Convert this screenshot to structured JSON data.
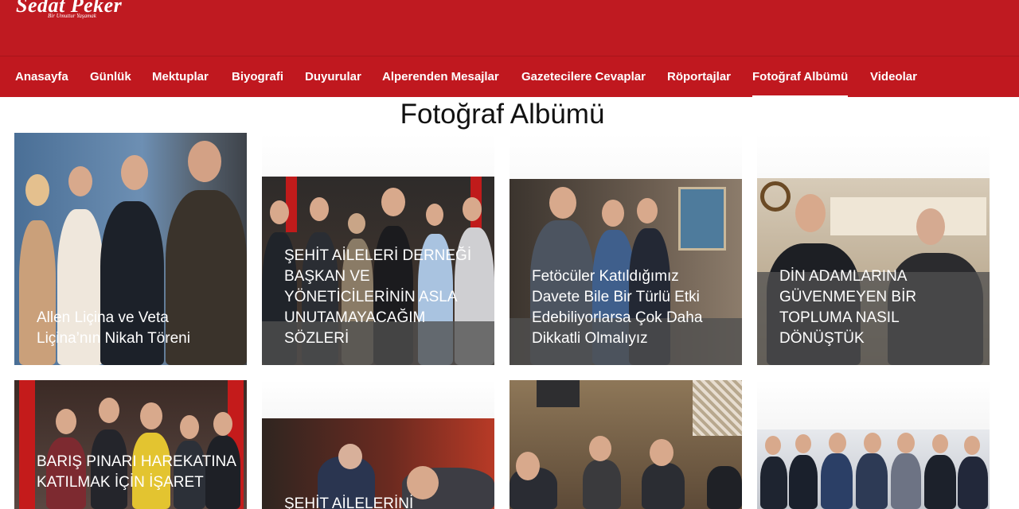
{
  "header": {
    "logo_main": "Sedat Peker",
    "logo_tagline": "Bir Umuttur Yaşamak"
  },
  "nav": {
    "items": [
      {
        "label": "Anasayfa"
      },
      {
        "label": "Günlük"
      },
      {
        "label": "Mektuplar"
      },
      {
        "label": "Biyografi"
      },
      {
        "label": "Duyurular"
      },
      {
        "label": "Alperenden Mesajlar"
      },
      {
        "label": "Gazetecilere Cevaplar"
      },
      {
        "label": "Röportajlar"
      },
      {
        "label": "Fotoğraf Albümü",
        "active": true
      },
      {
        "label": "Videolar"
      }
    ]
  },
  "page": {
    "title": "Fotoğraf Albümü"
  },
  "albums": [
    {
      "title": "Allen Liçina ve Veta Liçina’nın Nikah Töreni"
    },
    {
      "title": "ŞEHİT AİLELERİ DERNEĞİ BAŞKAN VE YÖNETİCİLERİNİN ASLA UNUTAMAYACAĞIM SÖZLERİ"
    },
    {
      "title": "Fetöcüler Katıldığımız Davete Bile Bir Türlü Etki Edebiliyorlarsa Çok Daha Dikkatli Olmalıyız"
    },
    {
      "title": "DİN ADAMLARINA GÜVENMEYEN BİR TOPLUMA NASIL DÖNÜŞTÜK"
    },
    {
      "title": "BARIŞ PINARI HAREKATINA KATILMAK İÇİN İŞARET"
    },
    {
      "title": "ŞEHİT AİLELERİNİ"
    },
    {
      "title": ""
    },
    {
      "title": ""
    }
  ],
  "colors": {
    "brand_red": "#bf1a21",
    "nav_red": "#c0181f",
    "caption_overlay": "#505050"
  }
}
